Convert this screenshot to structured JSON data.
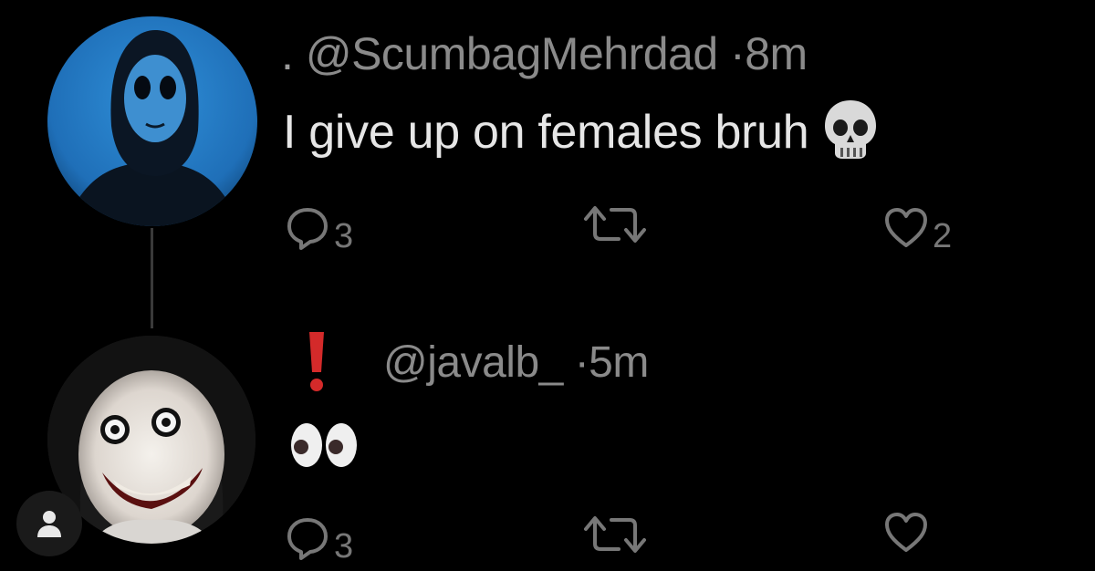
{
  "tweet1": {
    "prefix": ".",
    "handle": "@ScumbagMehrdad",
    "separator": "·",
    "time": "8m",
    "text": "I give up on females bruh",
    "emoji": "skull",
    "reply_count": "3",
    "like_count": "2"
  },
  "tweet2": {
    "badge": "red-exclamation",
    "handle": "@javalb_",
    "separator": "·",
    "time": "5m",
    "emoji": "eyes",
    "reply_count": "3"
  },
  "colors": {
    "background": "#000000",
    "text": "#e6e6e6",
    "muted": "#8a8a8a",
    "icon": "#777777",
    "accent_red": "#d42a2a"
  }
}
